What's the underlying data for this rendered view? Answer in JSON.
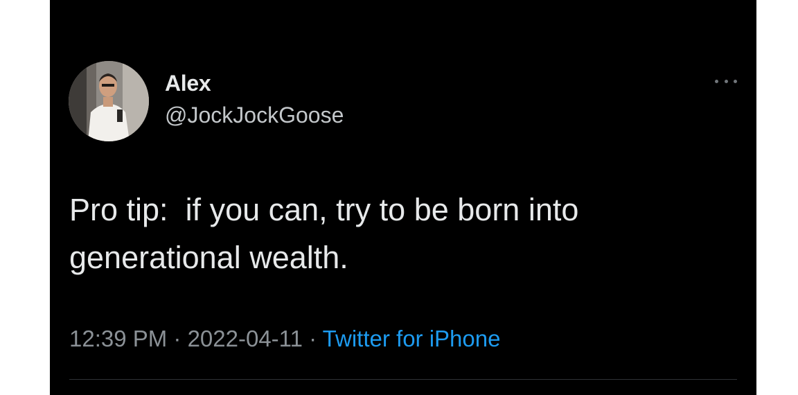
{
  "author": {
    "display_name": "Alex",
    "handle": "@JockJockGoose",
    "avatar_icon": "profile-photo"
  },
  "tweet": {
    "text": "Pro tip:  if you can, try to be born into\ngenerational wealth.",
    "time": "12:39 PM",
    "separator": " · ",
    "date": "2022-04-11",
    "source": "Twitter for iPhone"
  },
  "icons": {
    "more": "more-horizontal-icon"
  },
  "colors": {
    "background": "#000000",
    "text": "#e7e9ea",
    "muted": "#8b9196",
    "link": "#1d9bf0"
  }
}
